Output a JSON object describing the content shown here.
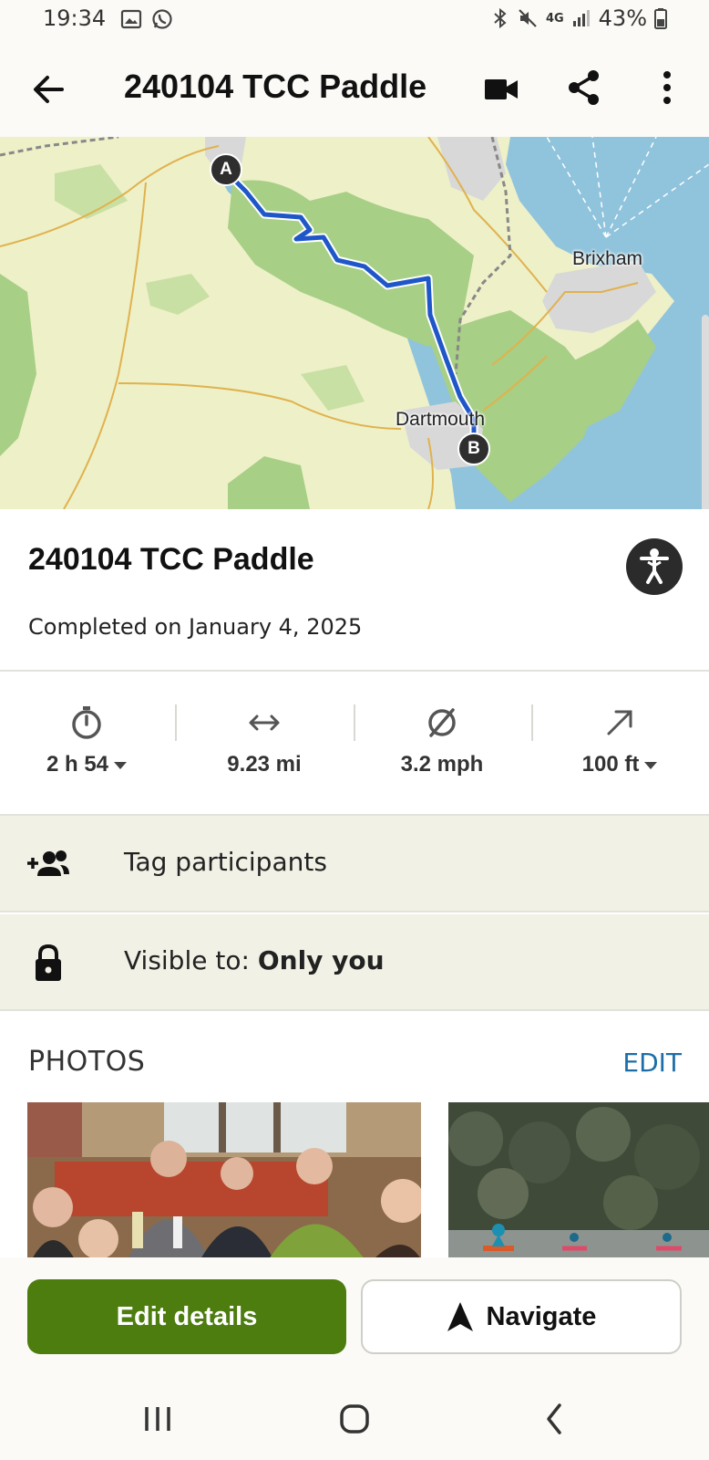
{
  "status_bar": {
    "time": "19:34",
    "network": "4G",
    "battery": "43%",
    "icons": [
      "gallery-icon",
      "whatsapp-icon",
      "bluetooth-icon",
      "mute-icon",
      "signal-icon",
      "battery-icon"
    ]
  },
  "app_bar": {
    "title": "240104 TCC Paddle",
    "icons": [
      "back-arrow-icon",
      "video-camera-icon",
      "share-icon",
      "more-vert-icon"
    ]
  },
  "map": {
    "labels": [
      "Brixham",
      "Dartmouth"
    ],
    "start_marker": "A",
    "end_marker": "B",
    "route_color": "#1f57c9"
  },
  "activity": {
    "title": "240104 TCC Paddle",
    "date": "Completed on January 4, 2025",
    "type_icon": "paddle-person-icon"
  },
  "stats": [
    {
      "icon": "stopwatch-icon",
      "value": "2 h 54",
      "has_dropdown": true
    },
    {
      "icon": "distance-icon",
      "value": "9.23 mi",
      "has_dropdown": false
    },
    {
      "icon": "average-speed-icon",
      "value": "3.2 mph",
      "has_dropdown": false
    },
    {
      "icon": "elevation-gain-icon",
      "value": "100 ft",
      "has_dropdown": true
    }
  ],
  "tag_row": {
    "label": "Tag participants",
    "icon": "add-people-icon"
  },
  "visibility_row": {
    "prefix": "Visible to:",
    "value": "Only you",
    "icon": "lock-icon"
  },
  "photos": {
    "heading": "PHOTOS",
    "edit": "EDIT",
    "count_visible": 2
  },
  "actions": {
    "edit": "Edit details",
    "navigate": "Navigate"
  },
  "colors": {
    "accent_green": "#4d7c0f",
    "link_blue": "#1d6ea8",
    "row_bg": "#f2f1e6"
  }
}
